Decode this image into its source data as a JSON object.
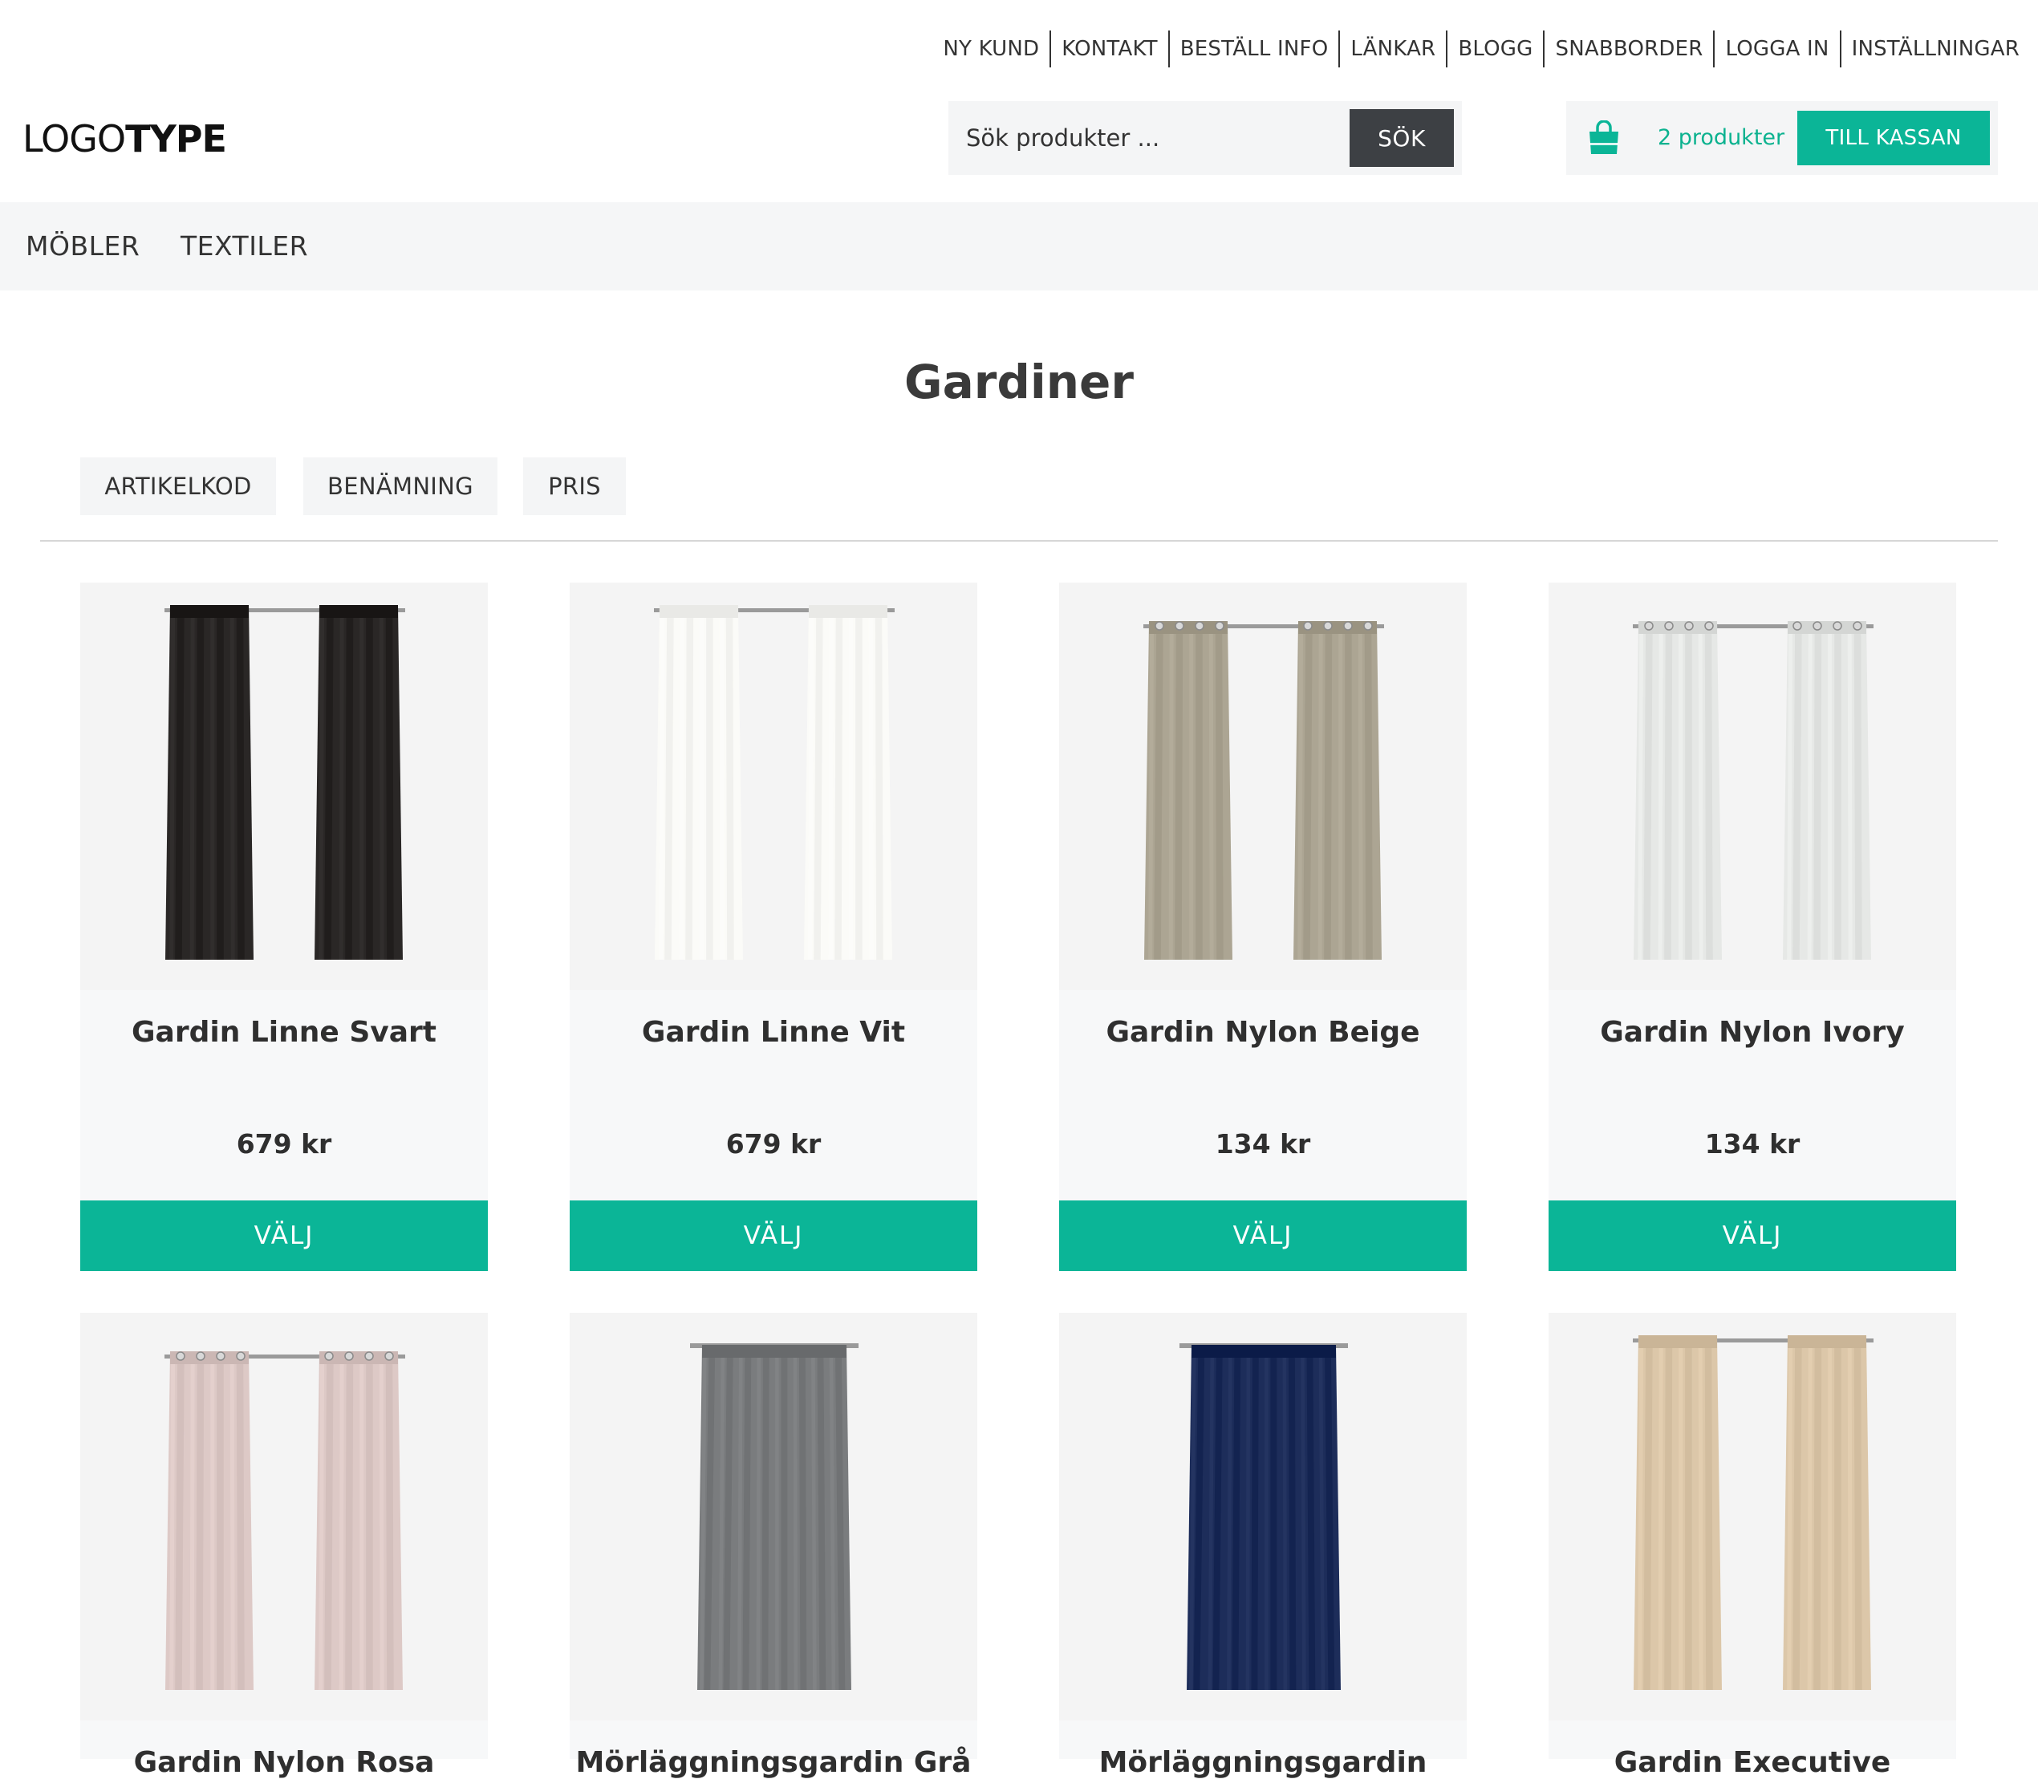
{
  "topnav": [
    "NY KUND",
    "KONTAKT",
    "BESTÄLL INFO",
    "LÄNKAR",
    "BLOGG",
    "SNABBORDER",
    "LOGGA IN",
    "INSTÄLLNINGAR"
  ],
  "logo": {
    "part1": "LOGO",
    "part2": "TYPE"
  },
  "search": {
    "placeholder": "Sök produkter ...",
    "button": "SÖK"
  },
  "cart": {
    "count_label": "2 produkter",
    "checkout_label": "TILL KASSAN",
    "accent": "#0bb597"
  },
  "categories": [
    "MÖBLER",
    "TEXTILER"
  ],
  "page": {
    "title": "Gardiner"
  },
  "sort": [
    "ARTIKELKOD",
    "BENÄMNING",
    "PRIS"
  ],
  "products": [
    {
      "name": "Gardin Linne Svart",
      "price": "679 kr",
      "button": "VÄLJ",
      "color": "#2a2726",
      "style": "pair-pleat"
    },
    {
      "name": "Gardin Linne Vit",
      "price": "679 kr",
      "button": "VÄLJ",
      "color": "#fbfbf8",
      "style": "pair-pleat"
    },
    {
      "name": "Gardin Nylon Beige",
      "price": "134 kr",
      "button": "VÄLJ",
      "color": "#aca593",
      "style": "pair-grommet"
    },
    {
      "name": "Gardin Nylon Ivory",
      "price": "134 kr",
      "button": "VÄLJ",
      "color": "#e6e8e6",
      "style": "pair-grommet"
    },
    {
      "name": "Gardin Nylon Rosa",
      "price": "",
      "button": "",
      "color": "#ddc9c6",
      "style": "pair-grommet"
    },
    {
      "name": "Mörläggningsgardin Grå",
      "price": "",
      "button": "",
      "color": "#7a7c7e",
      "style": "single"
    },
    {
      "name": "Mörläggningsgardin",
      "price": "",
      "button": "",
      "color": "#1d2d5a",
      "style": "single"
    },
    {
      "name": "Gardin Executive",
      "price": "",
      "button": "",
      "color": "#dcc7a9",
      "style": "pair-pleat"
    }
  ]
}
